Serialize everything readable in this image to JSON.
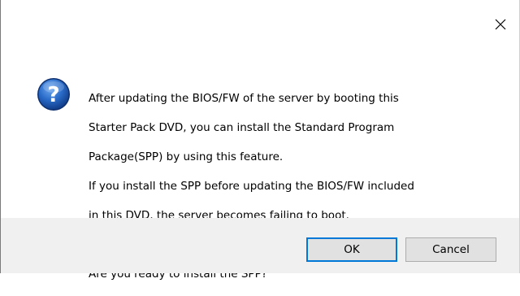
{
  "dialog": {
    "close_icon": "close-icon",
    "icon": "question-icon",
    "message_lines": [
      "After updating the BIOS/FW of the server by booting this",
      "Starter Pack DVD, you can install the Standard Program",
      "Package(SPP) by using this feature.",
      "If you install the SPP before updating the BIOS/FW included",
      "in this DVD, the server becomes failing to boot."
    ],
    "question": "Are you ready to install the SPP?",
    "buttons": {
      "ok_label": "OK",
      "cancel_label": "Cancel"
    },
    "colors": {
      "default_button_border": "#0078d7",
      "footer_bg": "#f0f0f0",
      "icon_blue": "#1f5fb8"
    }
  }
}
